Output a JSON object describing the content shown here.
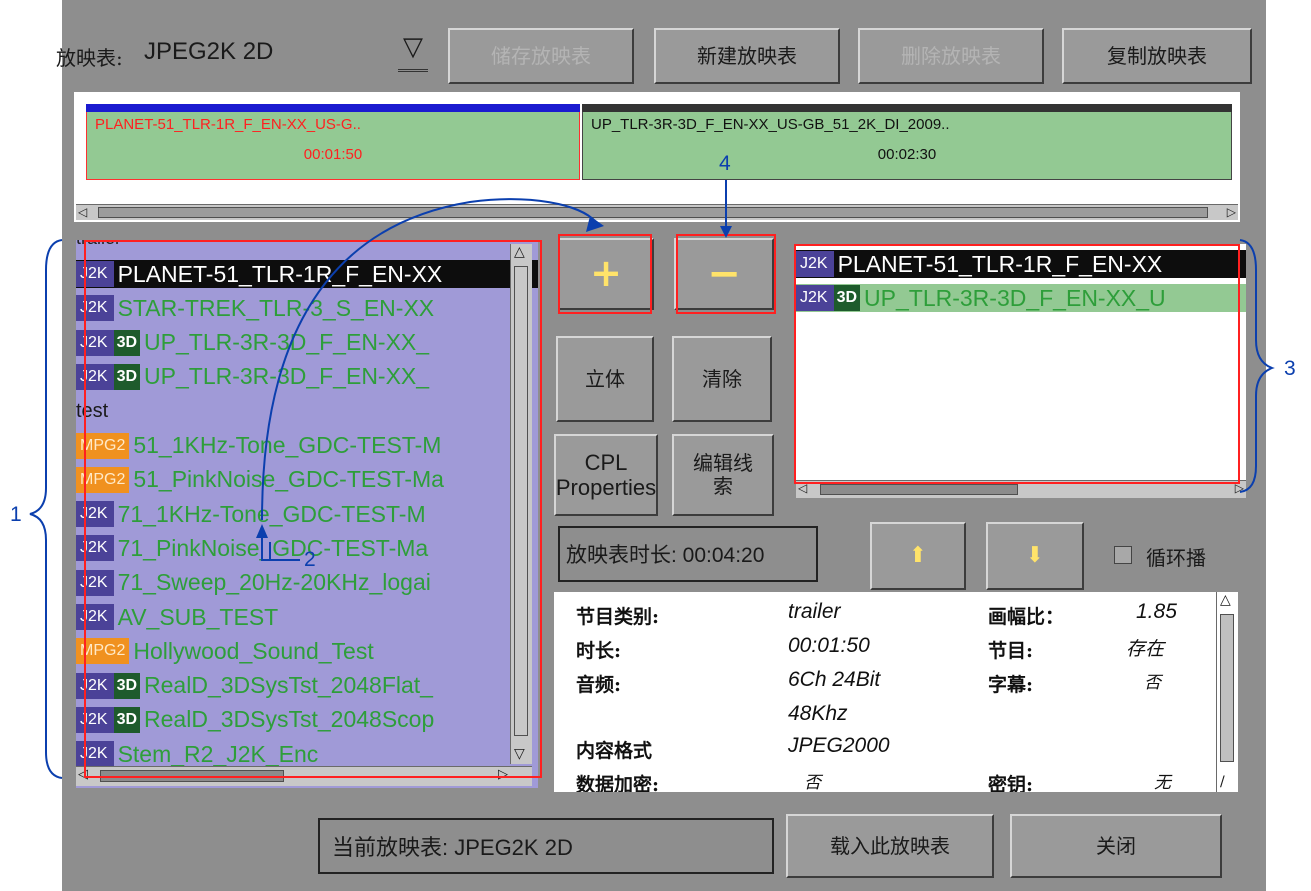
{
  "top": {
    "playlist_label": "放映表:",
    "playlist_value": "JPEG2K 2D",
    "dropdown_glyph": "▽",
    "buttons": {
      "save": "储存放映表",
      "new": "新建放映表",
      "delete": "删除放映表",
      "copy": "复制放映表"
    }
  },
  "timeline": {
    "clips": [
      {
        "name": "PLANET-51_TLR-1R_F_EN-XX_US-G..",
        "duration": "00:01:50"
      },
      {
        "name": "UP_TLR-3R-3D_F_EN-XX_US-GB_51_2K_DI_2009..",
        "duration": "00:02:30"
      }
    ]
  },
  "library": {
    "partial_header": "trailer",
    "rows": [
      {
        "badge": "J2K",
        "threed": "",
        "name": "PLANET-51_TLR-1R_F_EN-XX"
      },
      {
        "badge": "J2K",
        "threed": "",
        "name": "STAR-TREK_TLR-3_S_EN-XX"
      },
      {
        "badge": "J2K",
        "threed": "3D",
        "name": "UP_TLR-3R-3D_F_EN-XX_"
      },
      {
        "badge": "J2K",
        "threed": "3D",
        "name": "UP_TLR-3R-3D_F_EN-XX_"
      },
      {
        "group": "test"
      },
      {
        "badge": "MPG2",
        "threed": "",
        "name": "51_1KHz-Tone_GDC-TEST-M"
      },
      {
        "badge": "MPG2",
        "threed": "",
        "name": "51_PinkNoise_GDC-TEST-Ma"
      },
      {
        "badge": "J2K",
        "threed": "",
        "name": "71_1KHz-Tone_GDC-TEST-M"
      },
      {
        "badge": "J2K",
        "threed": "",
        "name": "71_PinkNoise_GDC-TEST-Ma"
      },
      {
        "badge": "J2K",
        "threed": "",
        "name": "71_Sweep_20Hz-20KHz_logai"
      },
      {
        "badge": "J2K",
        "threed": "",
        "name": "AV_SUB_TEST"
      },
      {
        "badge": "MPG2",
        "threed": "",
        "name": "Hollywood_Sound_Test"
      },
      {
        "badge": "J2K",
        "threed": "3D",
        "name": "RealD_3DSysTst_2048Flat_"
      },
      {
        "badge": "J2K",
        "threed": "3D",
        "name": "RealD_3DSysTst_2048Scop"
      },
      {
        "badge": "J2K",
        "threed": "",
        "name": "Stem_R2_J2K_Enc"
      }
    ]
  },
  "middle": {
    "add": "+",
    "remove": "−",
    "stereo": "立体",
    "clear": "清除",
    "cpl": "CPL Properties",
    "edit_cue": "编辑线索",
    "duration_label": "放映表时长: 00:04:20"
  },
  "playlist_panel": {
    "rows": [
      {
        "badge": "J2K",
        "threed": "",
        "name": "PLANET-51_TLR-1R_F_EN-XX"
      },
      {
        "badge": "J2K",
        "threed": "3D",
        "name": "UP_TLR-3R-3D_F_EN-XX_U"
      }
    ],
    "loop_label": "循环播"
  },
  "info": {
    "category_k": "节目类别:",
    "category_v": "trailer",
    "duration_k": "时长:",
    "duration_v": "00:01:50",
    "audio_k": "音频:",
    "audio_v": "6Ch 24Bit",
    "audio_v2": "48Khz",
    "format_k": "内容格式",
    "format_v": "JPEG2000",
    "encrypt_k": "数据加密:",
    "encrypt_v": "否",
    "aspect_k": "画幅比：",
    "aspect_v": "1.85",
    "program_k": "节目:",
    "program_v": "存在",
    "subtitle_k": "字幕:",
    "subtitle_v": "否",
    "key_k": "密钥:",
    "key_v": "无"
  },
  "bottom": {
    "current": "当前放映表: JPEG2K 2D",
    "load": "载入此放映表",
    "close": "关闭"
  },
  "annotations": {
    "n1": "1",
    "n2": "2",
    "n3": "3",
    "n4": "4"
  },
  "colors": {
    "badge_j2k": "#4b4298",
    "badge_mpg2": "#f0911f",
    "list_bg": "#a09ad7",
    "green": "#93c993",
    "annotation": "#0b3fae",
    "highlight": "#ff2020"
  }
}
